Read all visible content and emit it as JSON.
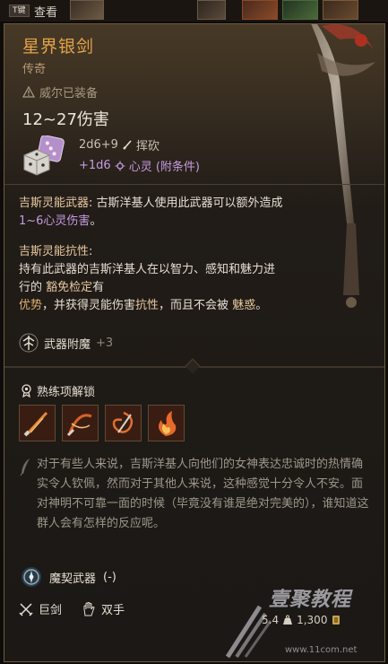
{
  "topbar": {
    "key_badge": "T键",
    "view_label": "查看"
  },
  "item": {
    "name": "星界银剑",
    "rarity": "传奇",
    "equipped_by": "威尔已装备",
    "damage": "12~27伤害",
    "damage_dice": "2d6+9",
    "damage_type": "挥砍",
    "bonus_damage": "+1d6",
    "bonus_type": "心灵 (附条件)"
  },
  "description": {
    "p1_title": "吉斯灵能武器",
    "p1_text": ": 古斯洋基人使用此武器可以额外造成",
    "p1_damage": "1~6心灵伤害",
    "p1_end": "。",
    "p2_title": "吉斯灵能抗性",
    "p2_colon": ":",
    "p2_line1": "持有此武器的吉斯洋基人在以智力、感知和魅力进",
    "p2_line2a": "行的",
    "p2_save": "豁免检定",
    "p2_line2b": "有",
    "p2_adv": "优势",
    "p2_line3a": "，并获得灵能伤害",
    "p2_resist": "抗性",
    "p2_line3b": "，而且不会被",
    "p2_charm": "魅惑",
    "p2_end": "。"
  },
  "enchant": {
    "label": "武器附魔",
    "value": "+3"
  },
  "proficiency": {
    "title": "熟练项解锁",
    "skills": [
      {
        "icon": "slash-skill-icon"
      },
      {
        "icon": "flourish-skill-icon"
      },
      {
        "icon": "swirl-skill-icon"
      },
      {
        "icon": "flame-strike-skill-icon"
      }
    ]
  },
  "lore": "对于有些人来说，吉斯洋基人向他们的女神表达忠诚时的热情确实令人钦佩，然而对于其他人来说，这种感觉十分令人不安。面对神明不可靠一面的时候（毕竟没有谁是绝对完美的），谁知道这群人会有怎样的反应呢。",
  "pact": {
    "label": "魔契武器",
    "value": "(-)"
  },
  "weapon_types": {
    "category": "巨剑",
    "handedness": "双手"
  },
  "footer": {
    "weight": "5.4",
    "price": "1,300"
  },
  "watermark": {
    "text": "壹聚教程",
    "url": "www.11com.net"
  },
  "colors": {
    "title": "#e3a34a",
    "psychic": "#c79ae0",
    "keyword": "#e8c9a0",
    "border": "#6e5a3f"
  }
}
